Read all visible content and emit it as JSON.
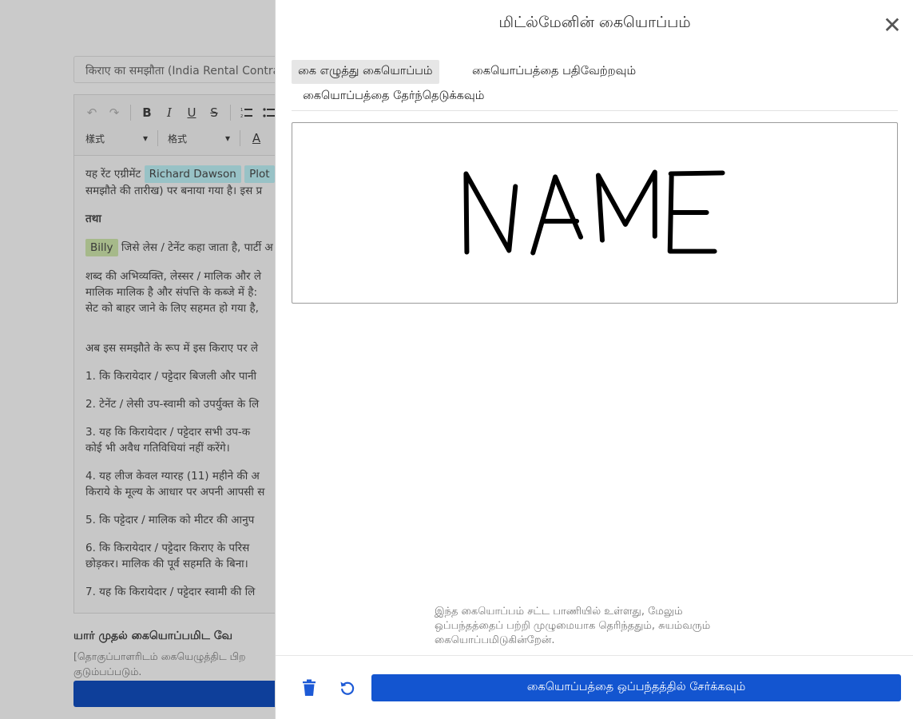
{
  "background": {
    "doc_title": "किराए का समझौता (India Rental Contract)",
    "toolbar": {
      "style_select": "樣式",
      "format_select": "格式"
    },
    "editor": {
      "p1_prefix": "यह रेंट एग्रीमेंट",
      "party_name": "Richard Dawson",
      "property_tag": "Plot",
      "p1_line2": "समझौते की तारीख) पर बनाया गया है। इस प्र",
      "and_word": "तथा",
      "tenant_name": "Billy",
      "p2_text": "जिसे लेस / टेनेंट कहा जाता है, पार्टी अ",
      "p3_line1": "शब्द की अभिव्यक्ति, लेस्सर / मालिक और ले",
      "p3_line2": "मालिक मालिक है और संपत्ति के कब्जे में है:",
      "p3_line3": "सेट को बाहर जाने के लिए सहमत हो गया है,",
      "p4": "अब इस समझौते के रूप में इस किराए पर ले",
      "item1": "1.    कि किरायेदार / पट्टेदार बिजली और पानी",
      "item2": "2.    टेनेंट / लेसी उप-स्वामी को उपर्युक्त के लि",
      "item3_l1": "3.    यह कि किरायेदार / पट्टेदार सभी उप-क",
      "item3_l2": "कोई भी अवैध गतिविधियां नहीं करेंगे।",
      "item4_l1": "4.    यह लीज केवल ग्यारह (11) महीने की अ",
      "item4_l2": "किराये के मूल्य के आधार पर अपनी आपसी स",
      "item5": "5.    कि पट्टेदार / मालिक को मीटर की आनुप",
      "item6_l1": "6.    कि किरायेदार / पट्टेदार किराए के परिस",
      "item6_l2": "छोड़कर। मालिक की पूर्व सहमति के बिना।",
      "item7": "7.    यह कि किरायेदार / पट्टेदार स्वामी की लि"
    },
    "who_signs": "யார் முதல் கையொப்பமிட வே",
    "who_note_l1": "[தொகுப்பாளரிடம் கையெழுத்திட பிற",
    "who_note_l2": "குடும்பப்படும்."
  },
  "modal": {
    "title": "மிட்ல்மேனின் கையொப்பம்",
    "close_symbol": "✕",
    "tabs": [
      {
        "label": "கை எழுத்து கையொப்பம்",
        "active": true
      },
      {
        "label": "கையொப்பத்தை பதிவேற்றவும்",
        "active": false
      },
      {
        "label": "கையொப்பத்தை தேர்ந்தெடுக்கவும்",
        "active": false
      }
    ],
    "legal_note": "இந்த கையொப்பம் சட்ட பாணியில் உள்ளது, மேலும் ஒப்பந்தத்தைப் பற்றி முழுமையாக தெரிந்ததும், சுயம்வரும் கையொப்பமிடுகின்றேன்.",
    "add_button": "கையொப்பத்தை ஒப்பந்தத்தில் சேர்க்கவும்",
    "colors": {
      "primary": "#1355d0",
      "icon": "#1d5ad6"
    }
  }
}
